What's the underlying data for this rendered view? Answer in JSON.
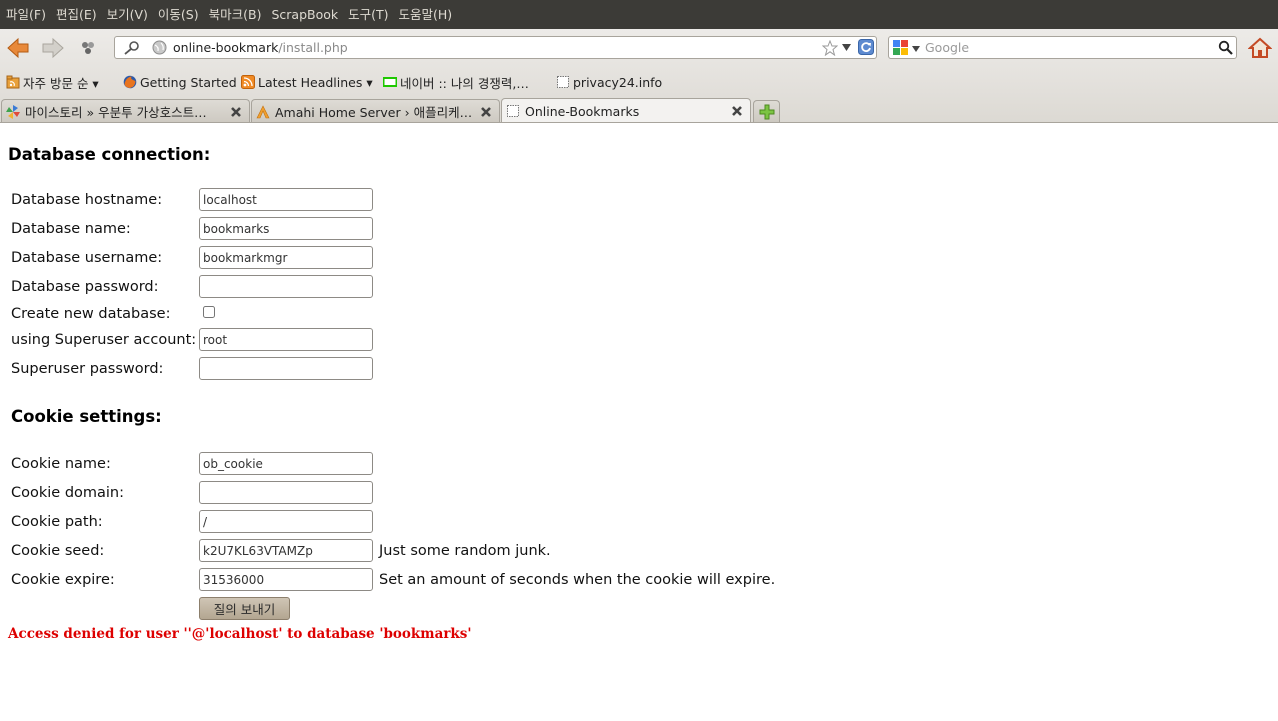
{
  "menubar": {
    "items": [
      "파일(F)",
      "편집(E)",
      "보기(V)",
      "이동(S)",
      "북마크(B)",
      "ScrapBook",
      "도구(T)",
      "도움말(H)"
    ]
  },
  "toolbar": {
    "url_host": "online-bookmark",
    "url_path": "/install.php",
    "search_placeholder": "Google"
  },
  "bookmarks": {
    "items": [
      {
        "label": "자주 방문 순 ▾",
        "icon": "rss-folder-icon"
      },
      {
        "label": "Getting Started",
        "icon": "firefox-icon"
      },
      {
        "label": "Latest Headlines ▾",
        "icon": "rss-icon"
      },
      {
        "label": "네이버 :: 나의 경쟁력,…",
        "icon": "naver-icon"
      },
      {
        "label": "privacy24.info",
        "icon": "blank-page-icon"
      }
    ]
  },
  "tabs": [
    {
      "label": "마이스토리 » 우분투 가상호스트…",
      "active": false
    },
    {
      "label": "Amahi Home Server › 애플리케…",
      "active": false
    },
    {
      "label": "Online-Bookmarks",
      "active": true
    }
  ],
  "page": {
    "db_heading": "Database connection:",
    "cookie_heading": "Cookie settings:",
    "db_fields": [
      {
        "label": "Database hostname:",
        "value": "localhost"
      },
      {
        "label": "Database name:",
        "value": "bookmarks"
      },
      {
        "label": "Database username:",
        "value": "bookmarkmgr"
      },
      {
        "label": "Database password:",
        "value": ""
      }
    ],
    "create_db_label": "Create new database:",
    "superuser_label": "using Superuser account:",
    "superuser_value": "root",
    "superuser_pw_label": "Superuser password:",
    "cookie_fields": [
      {
        "label": "Cookie name:",
        "value": "ob_cookie",
        "hint": ""
      },
      {
        "label": "Cookie domain:",
        "value": "",
        "hint": ""
      },
      {
        "label": "Cookie path:",
        "value": "/",
        "hint": ""
      },
      {
        "label": "Cookie seed:",
        "value": "k2U7KL63VTAMZp",
        "hint": "Just some random junk."
      },
      {
        "label": "Cookie expire:",
        "value": "31536000",
        "hint": "Set an amount of seconds when the cookie will expire."
      }
    ],
    "submit_label": "질의 보내기",
    "error": "Access denied for user ''@'localhost' to database 'bookmarks'"
  }
}
